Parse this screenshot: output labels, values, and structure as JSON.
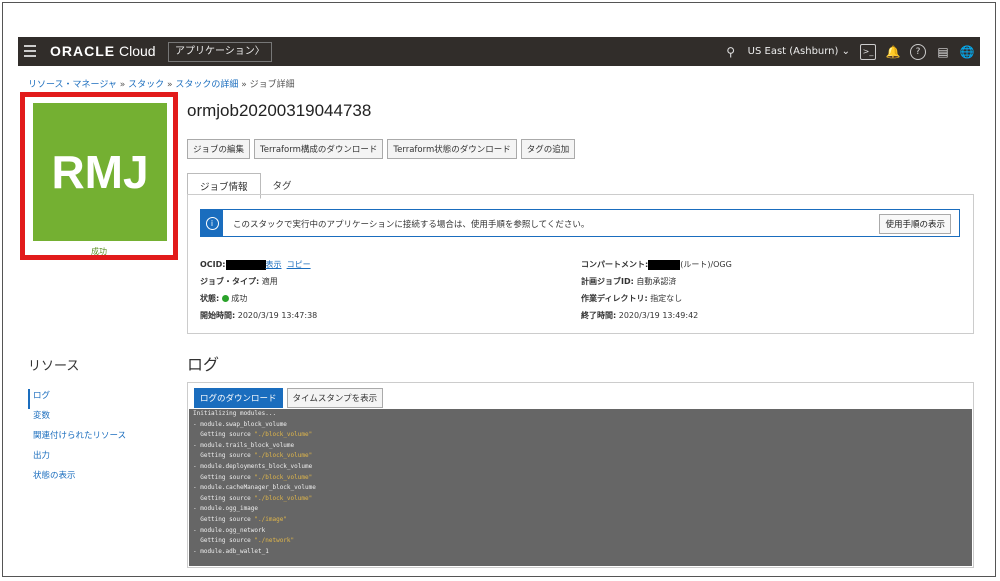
{
  "brand": {
    "name": "ORACLE",
    "product": "Cloud"
  },
  "topbar": {
    "apps_button": "アプリケーション〉",
    "region": "US East (Ashburn)",
    "icons": [
      "search-icon",
      "cloud-shell-icon",
      "bell-icon",
      "help-icon",
      "chat-icon",
      "globe-icon"
    ]
  },
  "breadcrumb": {
    "item1": "リソース・マネージャ",
    "item2": "スタック",
    "item3": "スタックの詳細",
    "current": "ジョブ詳細",
    "sep": " » "
  },
  "job_icon": {
    "initials": "RMJ",
    "status": "成功",
    "color": "#74b032"
  },
  "title": "ormjob20200319044738",
  "actions": [
    "ジョブの編集",
    "Terraform構成のダウンロード",
    "Terraform状態のダウンロード",
    "タグの追加"
  ],
  "tabs": [
    "ジョブ情報",
    "タグ"
  ],
  "info_banner": {
    "text": "このスタックで実行中のアプリケーションに接続する場合は、使用手順を参照してください。",
    "button": "使用手順の表示"
  },
  "details": {
    "ocid_label": "OCID:",
    "ocid_show": "表示",
    "ocid_copy": "コピー",
    "job_type_label": "ジョブ・タイプ:",
    "job_type": "適用",
    "state_label": "状態:",
    "state": "成功",
    "start_label": "開始時間:",
    "start": "2020/3/19 13:47:38",
    "compartment_label": "コンパートメント:",
    "compartment": "(ルート)/OGG",
    "plan_label": "計画ジョブID:",
    "plan": "自動承認済",
    "workdir_label": "作業ディレクトリ:",
    "workdir": "指定なし",
    "end_label": "終了時間:",
    "end": "2020/3/19 13:49:42"
  },
  "resources": {
    "title": "リソース",
    "items": [
      "ログ",
      "変数",
      "関連付けられたリソース",
      "出力",
      "状態の表示"
    ]
  },
  "log": {
    "title": "ログ",
    "download_button": "ログのダウンロード",
    "timestamp_button": "タイムスタンプを表示",
    "lines": [
      {
        "t": "Initializing modules...",
        "s": ""
      },
      {
        "t": "- module.swap_block_volume",
        "s": ""
      },
      {
        "t": "  Getting source ",
        "s": "\"./block_volume\""
      },
      {
        "t": "- module.trails_block_volume",
        "s": ""
      },
      {
        "t": "  Getting source ",
        "s": "\"./block_volume\""
      },
      {
        "t": "- module.deployments_block_volume",
        "s": ""
      },
      {
        "t": "  Getting source ",
        "s": "\"./block_volume\""
      },
      {
        "t": "- module.cacheManager_block_volume",
        "s": ""
      },
      {
        "t": "  Getting source ",
        "s": "\"./block_volume\""
      },
      {
        "t": "- module.ogg_image",
        "s": ""
      },
      {
        "t": "  Getting source ",
        "s": "\"./image\""
      },
      {
        "t": "- module.ogg_network",
        "s": ""
      },
      {
        "t": "  Getting source ",
        "s": "\"./network\""
      },
      {
        "t": "- module.adb_wallet_1",
        "s": ""
      }
    ]
  }
}
